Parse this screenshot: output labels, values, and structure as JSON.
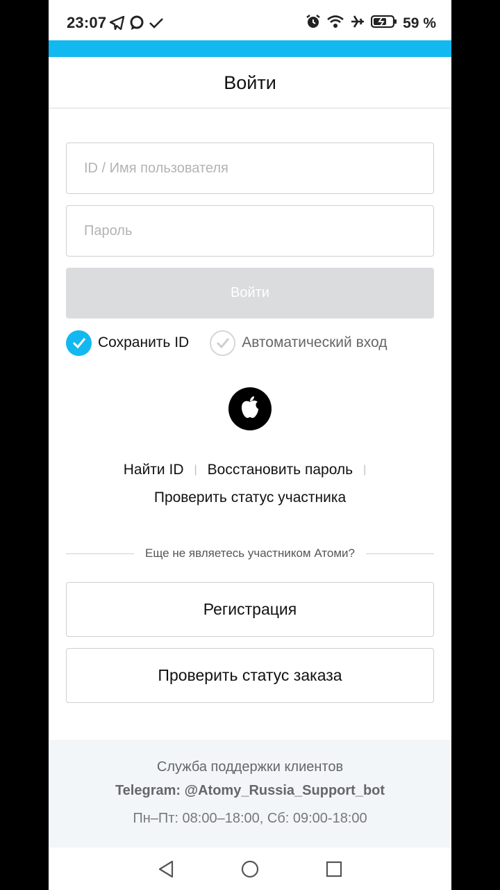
{
  "status_bar": {
    "time": "23:07",
    "left_icons": [
      "telegram-icon",
      "chat-bubble-icon",
      "check-icon"
    ],
    "right_icons": [
      "alarm-icon",
      "wifi-icon",
      "airplane-icon",
      "battery-charging-icon"
    ],
    "battery_percent": "59 %"
  },
  "accent_color": "#12b9f0",
  "header": {
    "title": "Войти"
  },
  "form": {
    "id_placeholder": "ID / Имя пользователя",
    "id_value": "",
    "password_placeholder": "Пароль",
    "password_value": "",
    "login_button": "Войти",
    "save_id_label": "Сохранить ID",
    "save_id_checked": true,
    "auto_login_label": "Автоматический вход",
    "auto_login_checked": false
  },
  "social": {
    "apple_icon": "apple-icon"
  },
  "links": {
    "find_id": "Найти ID",
    "restore_password": "Восстановить пароль",
    "check_member_status": "Проверить статус участника",
    "separator": "|"
  },
  "signup": {
    "prompt": "Еще не являетесь участником Атоми?",
    "register_button": "Регистрация",
    "check_order_button": "Проверить статус заказа"
  },
  "support": {
    "title": "Служба поддержки клиентов",
    "telegram": "Telegram: @Atomy_Russia_Support_bot",
    "hours": "Пн–Пт:  08:00–18:00, Сб: 09:00-18:00"
  },
  "nav_bar": {
    "icons": [
      "back-icon",
      "home-icon",
      "recents-icon"
    ]
  }
}
